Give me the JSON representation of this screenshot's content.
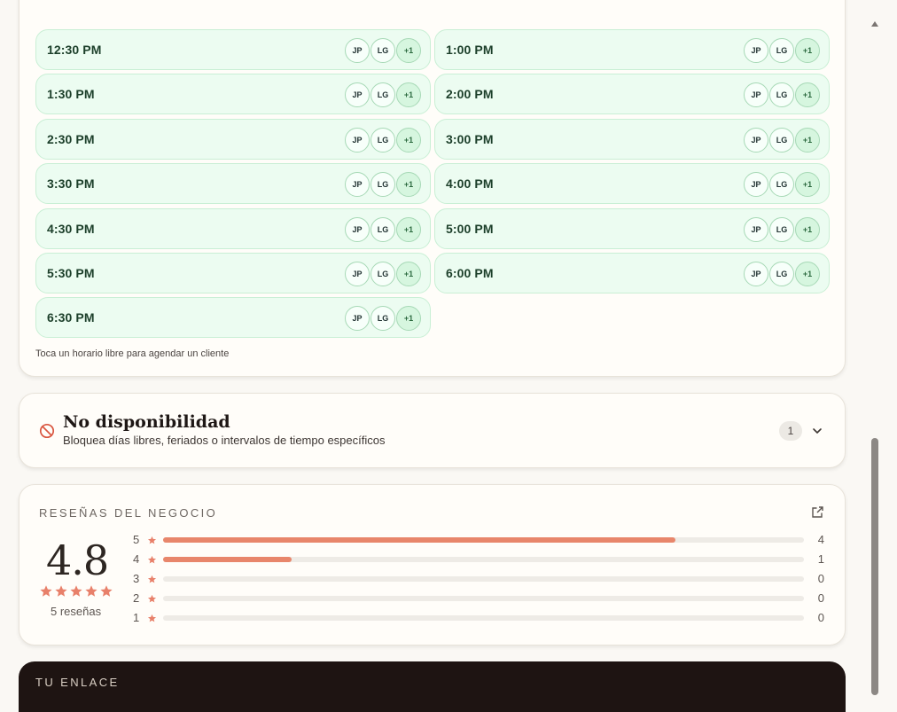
{
  "slots": {
    "items": [
      {
        "time": "12:30 PM",
        "avatars": [
          "JP",
          "LG",
          "+1"
        ]
      },
      {
        "time": "1:00 PM",
        "avatars": [
          "JP",
          "LG",
          "+1"
        ]
      },
      {
        "time": "1:30 PM",
        "avatars": [
          "JP",
          "LG",
          "+1"
        ]
      },
      {
        "time": "2:00 PM",
        "avatars": [
          "JP",
          "LG",
          "+1"
        ]
      },
      {
        "time": "2:30 PM",
        "avatars": [
          "JP",
          "LG",
          "+1"
        ]
      },
      {
        "time": "3:00 PM",
        "avatars": [
          "JP",
          "LG",
          "+1"
        ]
      },
      {
        "time": "3:30 PM",
        "avatars": [
          "JP",
          "LG",
          "+1"
        ]
      },
      {
        "time": "4:00 PM",
        "avatars": [
          "JP",
          "LG",
          "+1"
        ]
      },
      {
        "time": "4:30 PM",
        "avatars": [
          "JP",
          "LG",
          "+1"
        ]
      },
      {
        "time": "5:00 PM",
        "avatars": [
          "JP",
          "LG",
          "+1"
        ]
      },
      {
        "time": "5:30 PM",
        "avatars": [
          "JP",
          "LG",
          "+1"
        ]
      },
      {
        "time": "6:00 PM",
        "avatars": [
          "JP",
          "LG",
          "+1"
        ]
      },
      {
        "time": "6:30 PM",
        "avatars": [
          "JP",
          "LG",
          "+1"
        ]
      }
    ],
    "hint": "Toca un horario libre para agendar un cliente"
  },
  "unavailability": {
    "title": "No disponibilidad",
    "subtitle": "Bloquea días libres, feriados o intervalos de tiempo específicos",
    "count": "1",
    "icon": "ban-icon"
  },
  "reviews": {
    "title": "RESEÑAS DEL NEGOCIO",
    "score": "4.8",
    "count_label": "5 reseñas",
    "star_color": "#e8806a",
    "rows": [
      {
        "stars": "5",
        "count": "4",
        "fraction": 0.8
      },
      {
        "stars": "4",
        "count": "1",
        "fraction": 0.2
      },
      {
        "stars": "3",
        "count": "0",
        "fraction": 0
      },
      {
        "stars": "2",
        "count": "0",
        "fraction": 0
      },
      {
        "stars": "1",
        "count": "0",
        "fraction": 0
      }
    ]
  },
  "link": {
    "title": "TU ENLACE"
  },
  "colors": {
    "accent": "#e8866b",
    "slot_bg": "#ecfcf1",
    "dark_card": "#1e1412"
  }
}
